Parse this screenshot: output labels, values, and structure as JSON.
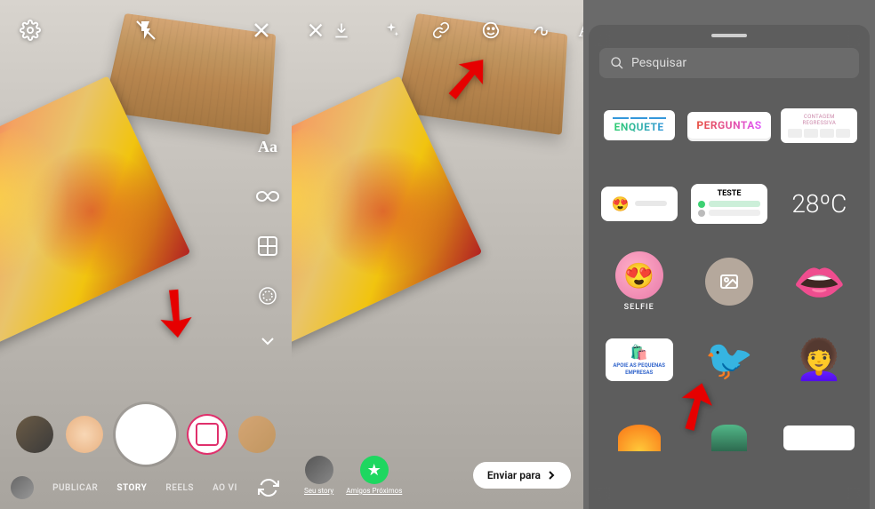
{
  "panel1": {
    "modes": {
      "publicar": "PUBLICAR",
      "story": "STORY",
      "reels": "REELS",
      "aovivo": "AO VI"
    }
  },
  "panel2": {
    "text_tool_label": "Aa",
    "your_story": "Seu story",
    "close_friends": "Amigos Próximos",
    "send_to": "Enviar para"
  },
  "panel3": {
    "search_placeholder": "Pesquisar",
    "stickers": {
      "enquete": "ENQUETE",
      "perguntas": "PERGUNTAS",
      "countdown": "CONTAGEM REGRESSIVA",
      "quiz": "TESTE",
      "temperature": "28ºC",
      "selfie": "SELFIE",
      "support_small_biz": "APOIE AS PEQUENAS EMPRESAS"
    }
  }
}
